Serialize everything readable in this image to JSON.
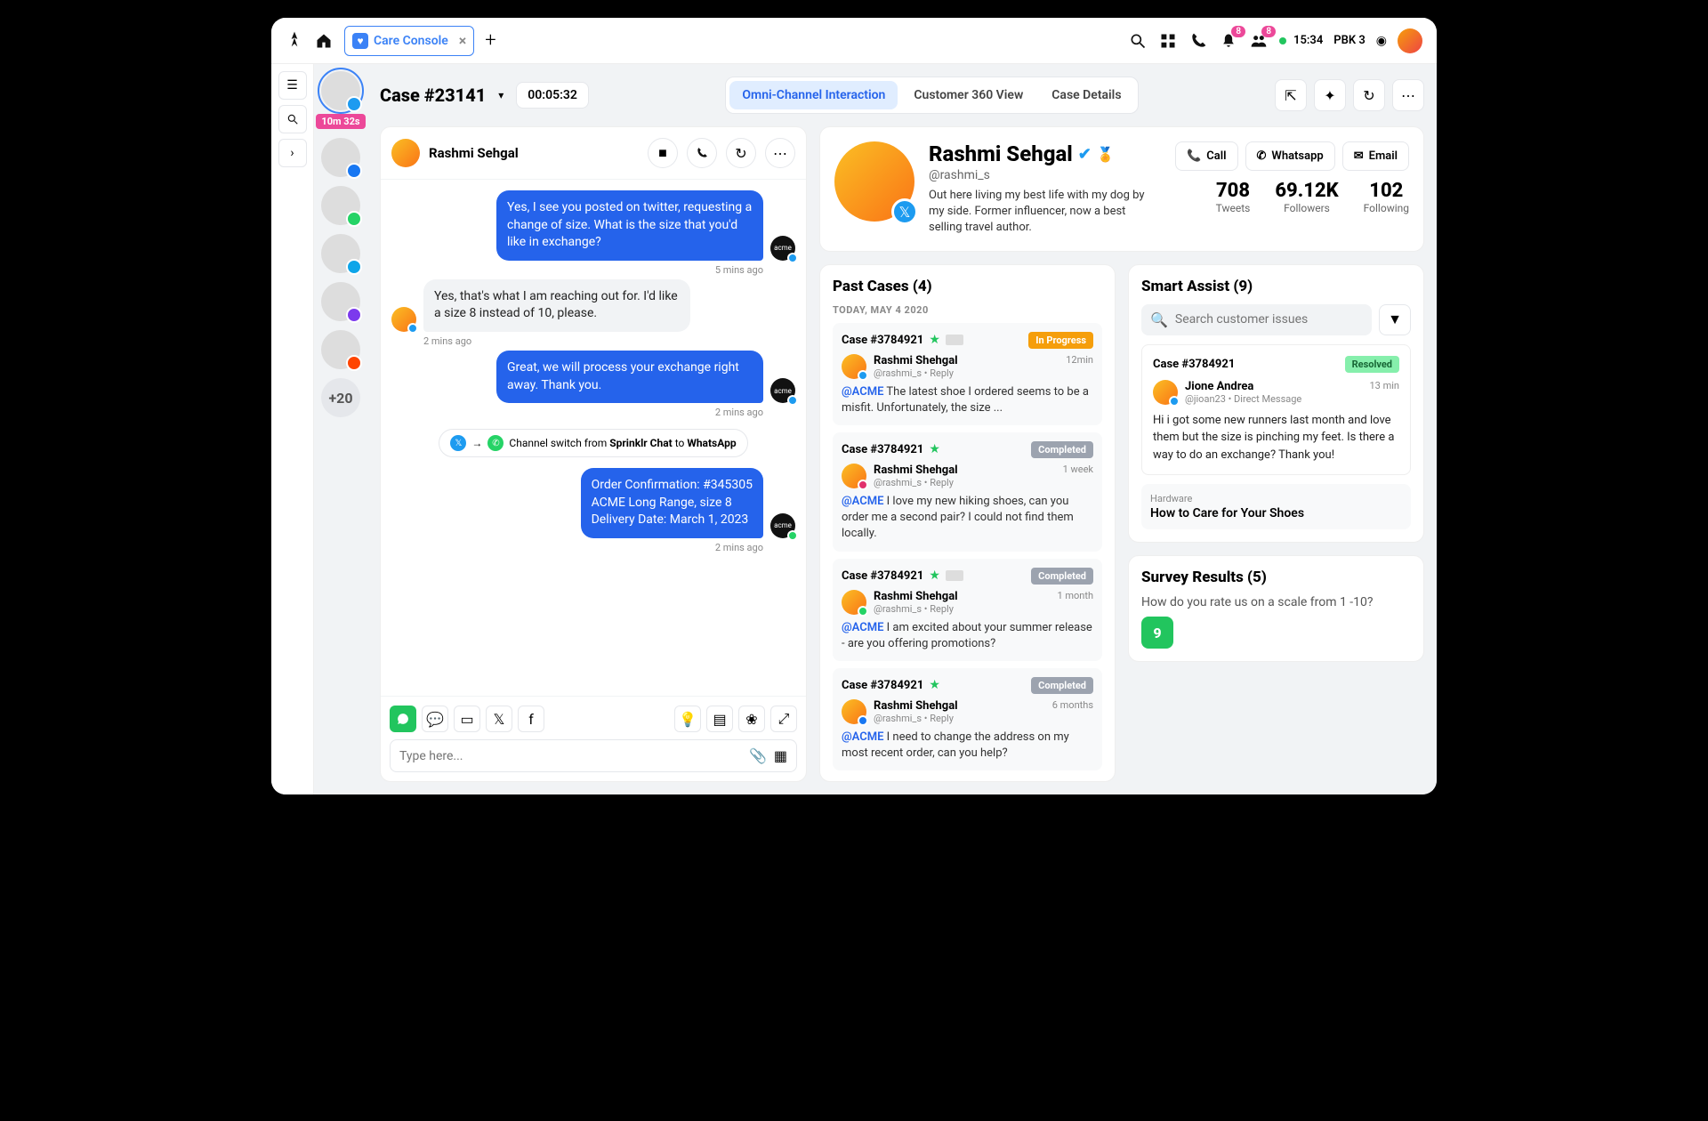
{
  "topbar": {
    "tab_label": "Care Console",
    "time": "15:34",
    "station": "PBK 3",
    "bell_badge": "8",
    "people_badge": "8"
  },
  "header": {
    "case_title": "Case #23141",
    "timer": "00:05:32",
    "tabs": [
      "Omni-Channel Interaction",
      "Customer 360 View",
      "Case Details"
    ]
  },
  "thumbs": {
    "timer": "10m 32s",
    "more": "+20"
  },
  "chat": {
    "name": "Rashmi Sehgal",
    "messages": [
      {
        "dir": "out",
        "text": "Yes, I see you posted on twitter, requesting a change of size. What is the size that you'd like in exchange?",
        "ts": "5 mins ago",
        "via": "tw"
      },
      {
        "dir": "in",
        "text": "Yes, that's what I am reaching out for. I'd like a size 8 instead of 10, please.",
        "ts": "2 mins ago"
      },
      {
        "dir": "out",
        "text": "Great, we will process your exchange right away. Thank you.",
        "ts": "2 mins ago",
        "via": "tw"
      },
      {
        "dir": "switch",
        "text_pre": "Channel switch from ",
        "from": "Sprinklr Chat",
        "mid": " to ",
        "to": "WhatsApp"
      },
      {
        "dir": "out",
        "text": "Order Confirmation: #345305\nACME Long Range, size 8\nDelivery Date: March 1, 2023",
        "ts": "2 mins ago",
        "via": "wa"
      }
    ],
    "placeholder": "Type here..."
  },
  "profile": {
    "name": "Rashmi Sehgal",
    "handle": "@rashmi_s",
    "bio": "Out here living my best life with my dog by my side. Former influencer, now a best selling travel author.",
    "actions": {
      "call": "Call",
      "whatsapp": "Whatsapp",
      "email": "Email"
    },
    "stats": [
      {
        "num": "708",
        "lbl": "Tweets"
      },
      {
        "num": "69.12K",
        "lbl": "Followers"
      },
      {
        "num": "102",
        "lbl": "Following"
      }
    ]
  },
  "past_cases": {
    "title": "Past Cases (4)",
    "date": "TODAY, MAY 4 2020",
    "items": [
      {
        "id": "Case #3784921",
        "status": "In Progress",
        "status_cls": "sp-prog",
        "name": "Rashmi Shehgal",
        "meta": "@rashmi_s • Reply",
        "time": "12min",
        "mention": "@ACME",
        "text": " The latest shoe I ordered seems to be a misfit. Unfortunately, the size ...",
        "ch": "tw",
        "flag": true
      },
      {
        "id": "Case #3784921",
        "status": "Completed",
        "status_cls": "sp-done",
        "name": "Rashmi Shehgal",
        "meta": "@rashmi_s • Reply",
        "time": "1 week",
        "mention": "@ACME",
        "text": " I love my new hiking shoes, can you order me a second pair? I could not find them locally.",
        "ch": "ig",
        "flag": false
      },
      {
        "id": "Case #3784921",
        "status": "Completed",
        "status_cls": "sp-done",
        "name": "Rashmi Shehgal",
        "meta": "@rashmi_s • Reply",
        "time": "1 month",
        "mention": "@ACME",
        "text": " I am excited about your summer release - are you offering promotions?",
        "ch": "wa",
        "flag": true
      },
      {
        "id": "Case #3784921",
        "status": "Completed",
        "status_cls": "sp-done",
        "name": "Rashmi Shehgal",
        "meta": "@rashmi_s • Reply",
        "time": "6 months",
        "mention": "@ACME",
        "text": " I need to change the address on my most recent order, can you help?",
        "ch": "fb",
        "flag": false
      }
    ]
  },
  "smart_assist": {
    "title": "Smart Assist (9)",
    "search_placeholder": "Search customer issues",
    "case": {
      "id": "Case #3784921",
      "status": "Resolved",
      "name": "Jione Andrea",
      "meta": "@jioan23 • Direct Message",
      "time": "13 min",
      "text": "Hi i got some new runners last month and love them but the size is pinching my feet. Is there a way to do an exchange? Thank you!"
    },
    "kb": {
      "cat": "Hardware",
      "title": "How to Care for Your Shoes"
    }
  },
  "survey": {
    "title": "Survey Results (5)",
    "question": "How do you rate us on a scale from 1 -10?",
    "score": "9"
  }
}
